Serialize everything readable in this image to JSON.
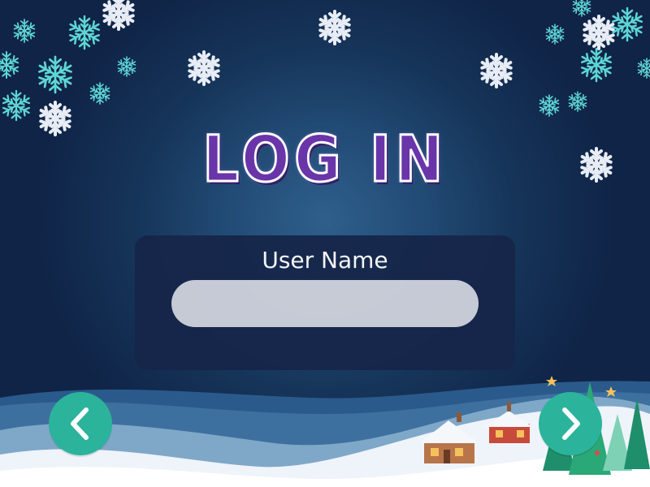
{
  "title": "LOG IN",
  "login_form": {
    "username_label": "User Name",
    "username_value": ""
  },
  "navigation": {
    "back_icon": "chevron-left-icon",
    "next_icon": "chevron-right-icon"
  },
  "colors": {
    "background_dark": "#0f2447",
    "background_glow": "#2f5f8c",
    "panel": "#16264a",
    "title_fill": "#6a35a8",
    "input_fill": "#cfd2dc",
    "nav_button": "#2bb39c",
    "snowflake_cyan": "#5fd6d6",
    "snowflake_white": "#e8edf5"
  },
  "icons": [
    "snowflake-icon",
    "house-icon",
    "christmas-tree-icon",
    "star-icon"
  ]
}
